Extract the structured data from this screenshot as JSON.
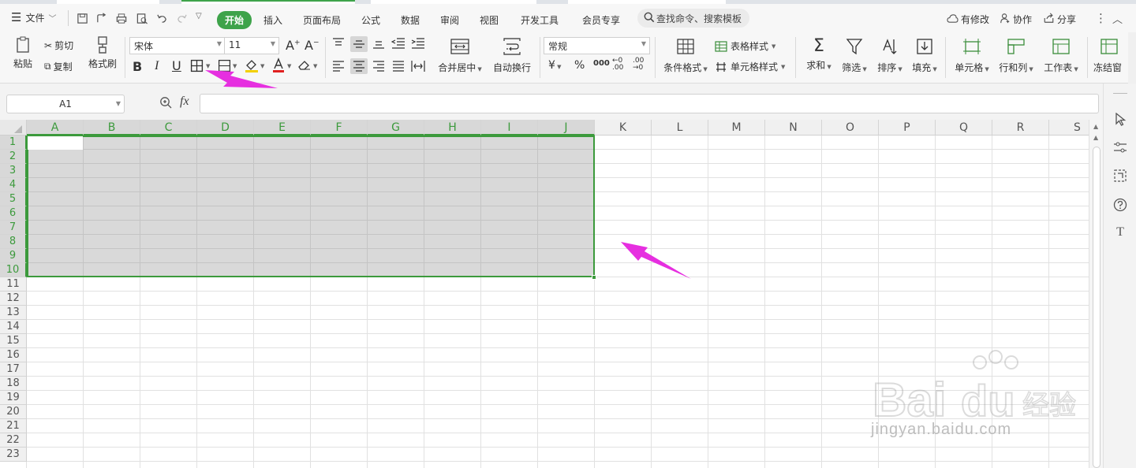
{
  "menu": {
    "file": "文件",
    "tabs": [
      "开始",
      "插入",
      "页面布局",
      "公式",
      "数据",
      "审阅",
      "视图",
      "开发工具",
      "会员专享"
    ],
    "search_placeholder": "查找命令、搜索模板",
    "right": {
      "modified": "有修改",
      "collab": "协作",
      "share": "分享"
    }
  },
  "ribbon": {
    "paste": "粘贴",
    "cut": "剪切",
    "copy": "复制",
    "format_painter": "格式刷",
    "font_name": "宋体",
    "font_size": "11",
    "bold": "B",
    "italic": "I",
    "underline": "U",
    "merge_center": "合并居中",
    "wrap_text": "自动换行",
    "number_format": "常规",
    "conditional_format": "条件格式",
    "table_style": "表格样式",
    "cell_style": "单元格样式",
    "sum": "求和",
    "filter": "筛选",
    "sort": "排序",
    "fill": "填充",
    "cell": "单元格",
    "row_col": "行和列",
    "worksheet": "工作表",
    "freeze": "冻结窗"
  },
  "formula_bar": {
    "name_box": "A1",
    "fx": "fx",
    "formula": ""
  },
  "sheet": {
    "columns": [
      "A",
      "B",
      "C",
      "D",
      "E",
      "F",
      "G",
      "H",
      "I",
      "J",
      "K",
      "L",
      "M",
      "N",
      "O",
      "P",
      "Q",
      "R",
      "S"
    ],
    "rows": [
      "1",
      "2",
      "3",
      "4",
      "5",
      "6",
      "7",
      "8",
      "9",
      "10",
      "11",
      "12",
      "13",
      "14",
      "15",
      "16",
      "17",
      "18",
      "19",
      "20",
      "21",
      "22",
      "23"
    ],
    "selected_range": "A1:J10"
  },
  "watermark": {
    "text": "jingyan.baidu.com",
    "brand": "Bai du 经验"
  },
  "colors": {
    "accent": "#3ea34a",
    "selection_border": "#3c9a3c",
    "annotation_arrow": "#e62fe0"
  }
}
